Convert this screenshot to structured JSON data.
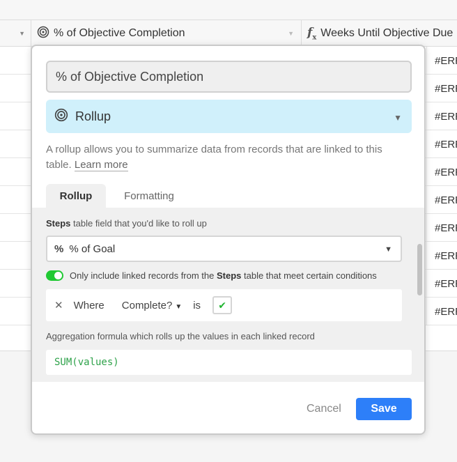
{
  "grid": {
    "columns": [
      {
        "label": "% of Objective Completion",
        "icon": "rollup-icon"
      },
      {
        "label": "Weeks Until Objective Due",
        "icon": "formula-icon"
      }
    ],
    "error_cells": [
      "#ERR",
      "#ERR",
      "#ERR",
      "#ERR",
      "#ERR",
      "#ERR",
      "#ERR",
      "#ERR",
      "#ERR",
      "#ERR"
    ]
  },
  "dialog": {
    "field_name": "% of Objective Completion",
    "field_type": "Rollup",
    "description": "A rollup allows you to summarize data from records that are linked to this table.",
    "learn_more": "Learn more",
    "tabs": [
      {
        "label": "Rollup",
        "active": true
      },
      {
        "label": "Formatting",
        "active": false
      }
    ],
    "rollup": {
      "linked_table": "Steps",
      "field_prompt_suffix": " table field that you'd like to roll up",
      "selected_field": "% of Goal",
      "condition_toggle": {
        "enabled": true,
        "text_prefix": "Only include linked records from the ",
        "table": "Steps",
        "text_suffix": " table that meet certain conditions"
      },
      "condition": {
        "where": "Where",
        "field": "Complete?",
        "operator": "is",
        "value_checked": true
      },
      "aggregation_label": "Aggregation formula which rolls up the values in each linked record",
      "formula": "SUM(values)"
    },
    "buttons": {
      "cancel": "Cancel",
      "save": "Save"
    }
  },
  "colors": {
    "accent": "#2d7ff9",
    "type_bg": "#d0f0fb",
    "toggle_on": "#20c933",
    "formula_text": "#2ea24a"
  }
}
